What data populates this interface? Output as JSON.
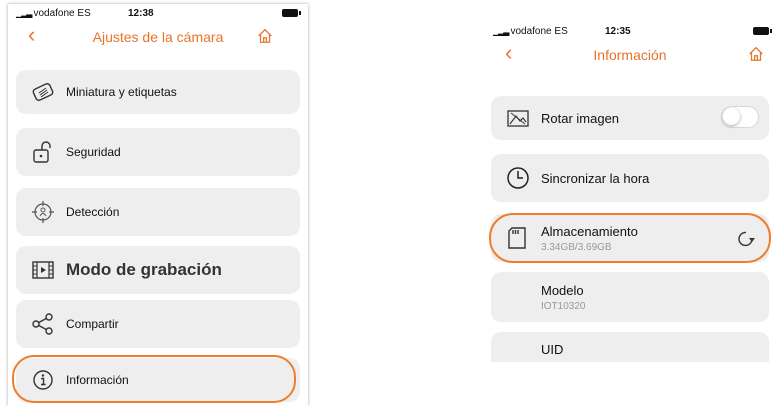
{
  "left_screen": {
    "status": {
      "carrier": "vodafone ES",
      "time": "12:38"
    },
    "header": {
      "back": "‹",
      "title": "Ajustes de la cámara",
      "home_icon": "home-icon"
    },
    "items": [
      {
        "label": "Miniatura y etiquetas",
        "icon": "tag-icon"
      },
      {
        "label": "Seguridad",
        "icon": "unlock-icon"
      },
      {
        "label": "Detección",
        "icon": "motion-detect-icon"
      },
      {
        "label": "Modo de grabación",
        "icon": "film-icon"
      },
      {
        "label": "Compartir",
        "icon": "share-icon"
      },
      {
        "label": "Información",
        "icon": "info-icon"
      }
    ]
  },
  "right_screen": {
    "status": {
      "carrier": "vodafone ES",
      "time": "12:35"
    },
    "header": {
      "back": "‹",
      "title": "Información",
      "home_icon": "home-icon"
    },
    "items": [
      {
        "label": "Rotar imagen",
        "icon": "rotate-image-icon",
        "toggle_on": false
      },
      {
        "label": "Sincronizar la hora",
        "icon": "clock-icon"
      },
      {
        "label": "Almacenamiento",
        "value": "3.34GB/3.69GB",
        "icon": "sd-card-icon",
        "action_icon": "refresh-icon"
      },
      {
        "label": "Modelo",
        "value": "IOT10320"
      },
      {
        "label": "UID"
      }
    ]
  },
  "colors": {
    "accent": "#e8742a",
    "highlight": "#ee7d2c",
    "card": "#eeeeee"
  }
}
